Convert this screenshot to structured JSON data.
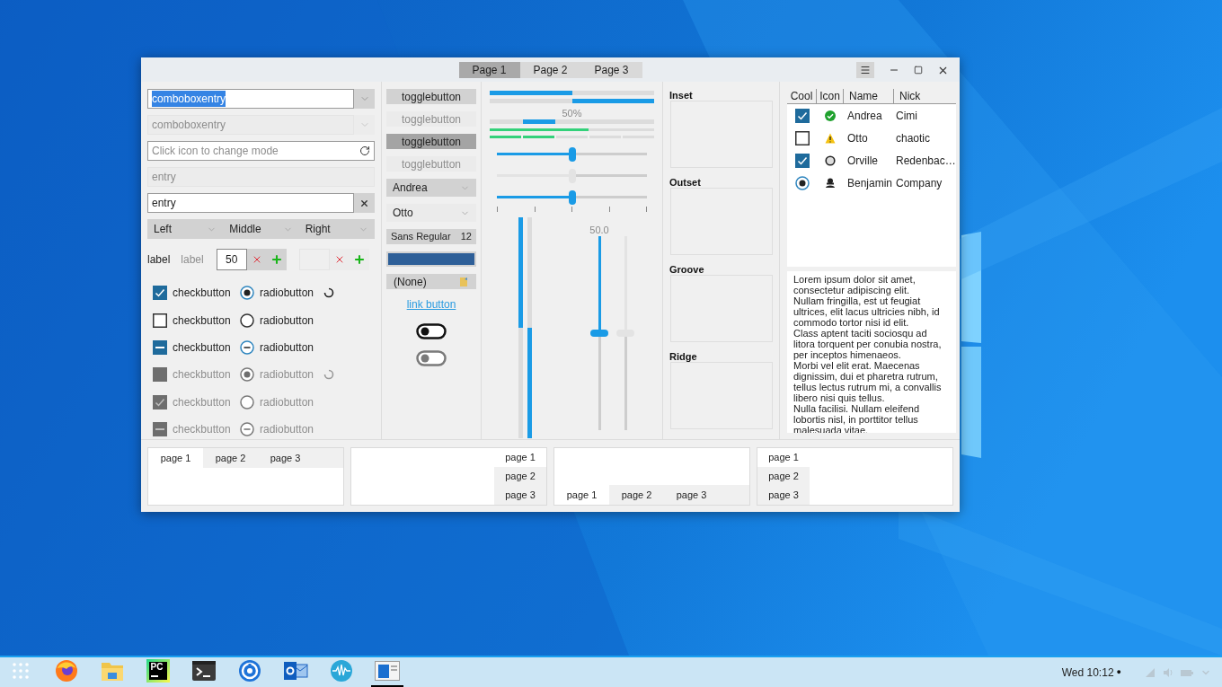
{
  "window": {
    "tabs": [
      {
        "label": "Page 1",
        "selected": true
      },
      {
        "label": "Page 2",
        "selected": false
      },
      {
        "label": "Page 3",
        "selected": false
      }
    ]
  },
  "entries": [
    {
      "kind": "combo",
      "value": "comboboxentry",
      "highlighted": true,
      "disabled": false
    },
    {
      "kind": "combo",
      "value": "comboboxentry",
      "highlighted": false,
      "disabled": true
    },
    {
      "kind": "mode",
      "placeholder": "Click icon to change mode",
      "disabled": false
    },
    {
      "kind": "plain",
      "value": "entry",
      "disabled": true
    },
    {
      "kind": "clear",
      "value": "entry",
      "disabled": false
    }
  ],
  "segmented_combo": [
    {
      "label": "Left"
    },
    {
      "label": "Middle"
    },
    {
      "label": "Right"
    }
  ],
  "labels": [
    {
      "text": "label",
      "disabled": false
    },
    {
      "text": "label",
      "disabled": true
    }
  ],
  "spin_buttons": [
    {
      "value": "50",
      "disabled": false
    },
    {
      "disabled": true
    }
  ],
  "check_rows": [
    {
      "check": {
        "label": "checkbutton",
        "checked": true,
        "mixed": false
      },
      "radio": {
        "label": "radiobutton",
        "selected": true,
        "mixed": false
      },
      "spinner": true,
      "disabled": false
    },
    {
      "check": {
        "label": "checkbutton",
        "checked": false,
        "mixed": false
      },
      "radio": {
        "label": "radiobutton",
        "selected": false,
        "mixed": false
      },
      "spinner": false,
      "disabled": false
    },
    {
      "check": {
        "label": "checkbutton",
        "mixed": true
      },
      "radio": {
        "label": "radiobutton",
        "mixed": true
      },
      "spinner": false,
      "disabled": false
    },
    {
      "check": {
        "label": "checkbutton",
        "checked": false,
        "mixed": false
      },
      "radio": {
        "label": "radiobutton",
        "selected": true,
        "mixed": false
      },
      "spinner": true,
      "disabled": true
    },
    {
      "check": {
        "label": "checkbutton",
        "checked": true,
        "mixed": false
      },
      "radio": {
        "label": "radiobutton",
        "selected": false,
        "mixed": false
      },
      "spinner": false,
      "disabled": true
    },
    {
      "check": {
        "label": "checkbutton",
        "mixed": true
      },
      "radio": {
        "label": "radiobutton",
        "mixed": true
      },
      "spinner": false,
      "disabled": true
    }
  ],
  "toggle_buttons": [
    {
      "label": "togglebutton",
      "active": false,
      "disabled": false
    },
    {
      "label": "togglebutton",
      "active": false,
      "disabled": true
    },
    {
      "label": "togglebutton",
      "active": true,
      "disabled": false
    },
    {
      "label": "togglebutton",
      "active": false,
      "disabled": true
    }
  ],
  "combos": [
    {
      "value": "Andrea",
      "kind": "button"
    },
    {
      "value": "Otto",
      "kind": "flat"
    }
  ],
  "font_button": {
    "family": "Sans Regular",
    "size": "12"
  },
  "color_button": {
    "color": "#2e5f98"
  },
  "file_button": {
    "label": "(None)"
  },
  "link_button": {
    "label": "link button"
  },
  "switches": [
    {
      "disabled": false
    },
    {
      "disabled": true
    }
  ],
  "progress_bars": [
    {
      "kind": "bar",
      "level": 0.5,
      "inverted": false
    },
    {
      "kind": "bar",
      "level": 0.5,
      "inverted": true
    },
    {
      "kind": "pulse",
      "text": "50%"
    }
  ],
  "level_bars": [
    {
      "kind": "continuous",
      "level": 0.6
    },
    {
      "kind": "discrete",
      "level": 0.4
    }
  ],
  "h_scales": [
    {
      "level": 0.5,
      "disabled": false,
      "marks": false
    },
    {
      "level": 0.5,
      "disabled": true,
      "marks": false
    },
    {
      "level": 0.5,
      "disabled": false,
      "marks": true
    }
  ],
  "v_progress": [
    {
      "level": 0.5,
      "inverted": false
    },
    {
      "level": 0.5,
      "inverted": true
    }
  ],
  "v_scales": [
    {
      "level": 0.5,
      "disabled": false,
      "reading": "50.0"
    },
    {
      "level": 0.5,
      "disabled": true
    }
  ],
  "frames": [
    {
      "label": "Inset"
    },
    {
      "label": "Outset"
    },
    {
      "label": "Groove"
    },
    {
      "label": "Ridge"
    }
  ],
  "tree": {
    "columns": [
      "Cool",
      "Icon",
      "Name",
      "Nick"
    ],
    "rows": [
      {
        "cool": {
          "kind": "check",
          "checked": true
        },
        "name": "Andrea",
        "nick": "Cimi"
      },
      {
        "cool": {
          "kind": "check",
          "checked": false
        },
        "name": "Otto",
        "nick": "chaotic"
      },
      {
        "cool": {
          "kind": "check",
          "checked": true
        },
        "name": "Orville",
        "nick": "Redenbac…"
      },
      {
        "cool": {
          "kind": "radio",
          "checked": true
        },
        "name": "Benjamin",
        "nick": "Company"
      }
    ]
  },
  "text_view": {
    "paragraphs": [
      "Lorem ipsum dolor sit amet, consectetur adipiscing elit.",
      "Nullam fringilla, est ut feugiat ultrices, elit lacus ultricies nibh, id commodo tortor nisi id elit.",
      "Class aptent taciti sociosqu ad litora torquent per conubia nostra, per inceptos himenaeos.",
      "Morbi vel elit erat. Maecenas dignissim, dui et pharetra rutrum, tellus lectus rutrum mi, a convallis libero nisi quis tellus.",
      "Nulla facilisi. Nullam eleifend lobortis nisl, in porttitor tellus malesuada vitae."
    ]
  },
  "notebooks": [
    {
      "tabs": [
        {
          "label": "page 1",
          "selected": true
        },
        {
          "label": "page 2",
          "selected": false
        },
        {
          "label": "page 3",
          "selected": false
        }
      ]
    },
    {
      "tabs": [
        {
          "label": "page 1",
          "selected": true
        },
        {
          "label": "page 2",
          "selected": false
        },
        {
          "label": "page 3",
          "selected": false
        }
      ]
    },
    {
      "tabs": [
        {
          "label": "page 1",
          "selected": true
        },
        {
          "label": "page 2",
          "selected": false
        },
        {
          "label": "page 3",
          "selected": false
        }
      ]
    },
    {
      "tabs": [
        {
          "label": "page 1",
          "selected": true
        },
        {
          "label": "page 2",
          "selected": false
        },
        {
          "label": "page 3",
          "selected": false
        }
      ]
    }
  ],
  "taskbar": {
    "apps": [
      {
        "kind": "grid",
        "active": false
      },
      {
        "kind": "browser",
        "active": false
      },
      {
        "kind": "folder",
        "active": false
      },
      {
        "kind": "ide",
        "text": "PC",
        "active": false
      },
      {
        "kind": "terminal",
        "active": false
      },
      {
        "kind": "ring",
        "active": false
      },
      {
        "kind": "mail",
        "active": false
      },
      {
        "kind": "wave",
        "active": false
      },
      {
        "kind": "window",
        "active": true
      }
    ],
    "clock": "Wed 10:12",
    "indicator": "●"
  }
}
